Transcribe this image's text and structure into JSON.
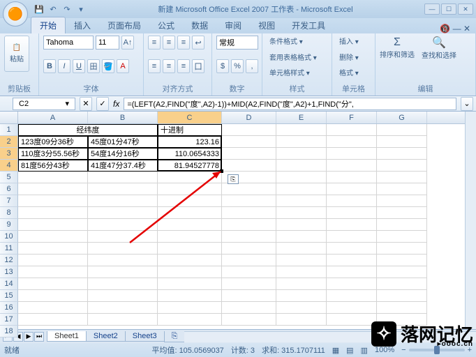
{
  "title": "新建 Microsoft Office Excel 2007 工作表 - Microsoft Excel",
  "tabs": {
    "t0": "开始",
    "t1": "插入",
    "t2": "页面布局",
    "t3": "公式",
    "t4": "数据",
    "t5": "审阅",
    "t6": "视图",
    "t7": "开发工具"
  },
  "ribbon": {
    "paste": "粘贴",
    "clipboard": "剪贴板",
    "font_name": "Tahoma",
    "font_size": "11",
    "font_grp": "字体",
    "align_grp": "对齐方式",
    "number_fmt": "常规",
    "number_grp": "数字",
    "cond": "条件格式 ▾",
    "table": "套用表格格式 ▾",
    "cellstyle": "单元格样式 ▾",
    "style_grp": "样式",
    "insert": "插入 ▾",
    "delete": "删除 ▾",
    "format": "格式 ▾",
    "cell_grp": "单元格",
    "sort": "排序和筛选",
    "find": "查找和选择",
    "edit_grp": "编辑"
  },
  "namebox": "C2",
  "formula": "=(LEFT(A2,FIND(\"度\",A2)-1))+MID(A2,FIND(\"度\",A2)+1,FIND(\"分\",",
  "headers": {
    "A": "A",
    "B": "B",
    "C": "C",
    "D": "D",
    "E": "E",
    "F": "F",
    "G": "G"
  },
  "rows": [
    "1",
    "2",
    "3",
    "4",
    "5",
    "6",
    "7",
    "8",
    "9",
    "10",
    "11",
    "12",
    "13",
    "14",
    "15",
    "16",
    "17",
    "18"
  ],
  "cells": {
    "A1": "经纬度",
    "C1": "十进制",
    "A2": "123度09分36秒",
    "B2": "45度01分47秒",
    "C2": "123.16",
    "A3": "110度3分55.56秒",
    "B3": "54度14分16秒",
    "C3": "110.0654333",
    "A4": "81度56分43秒",
    "B4": "41度47分37.4秒",
    "C4": "81.94527778"
  },
  "sheets": {
    "s1": "Sheet1",
    "s2": "Sheet2",
    "s3": "Sheet3"
  },
  "status": {
    "ready": "就绪",
    "avg": "平均值: 105.0569037",
    "count": "计数: 3",
    "sum": "求和: 315.1707111",
    "zoom": "100%"
  },
  "watermark": {
    "txt": "落网记忆",
    "sub": "▸oooc.cn"
  }
}
